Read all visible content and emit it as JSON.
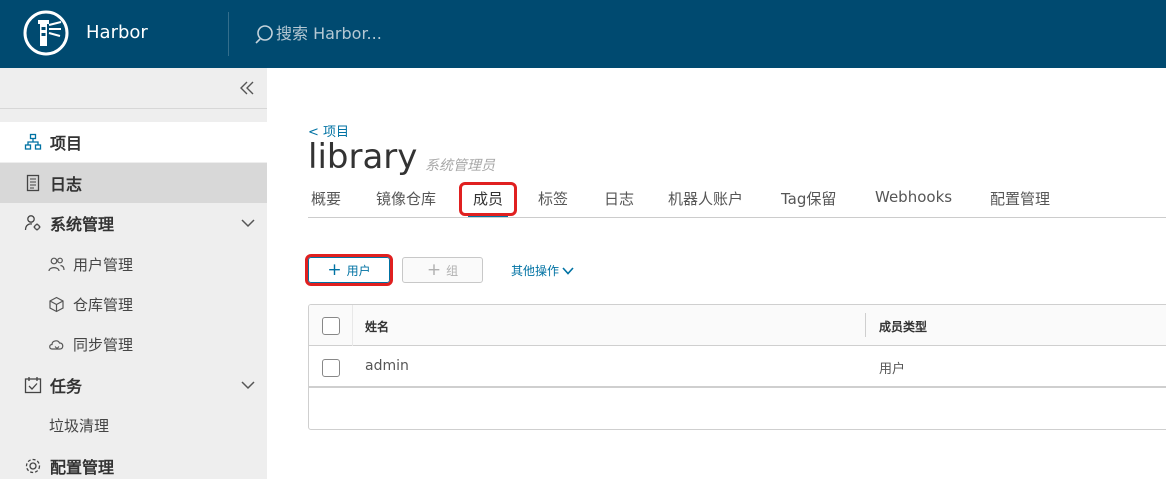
{
  "header": {
    "app_title": "Harbor",
    "search_placeholder": "搜索 Harbor...",
    "background_color": "#004a70"
  },
  "sidebar": {
    "items": [
      {
        "label": "项目",
        "icon": "project-tree-icon"
      },
      {
        "label": "日志",
        "icon": "logs-document-icon"
      },
      {
        "label": "系统管理",
        "icon": "user-gear-icon"
      },
      {
        "label": "用户管理",
        "icon": "users-icon"
      },
      {
        "label": "仓库管理",
        "icon": "cube-icon"
      },
      {
        "label": "同步管理",
        "icon": "cloud-sync-icon"
      },
      {
        "label": "任务",
        "icon": "calendar-check-icon"
      },
      {
        "label": "垃圾清理"
      },
      {
        "label": "配置管理",
        "icon": "gear-icon"
      }
    ]
  },
  "main": {
    "breadcrumb": "< 项目",
    "title": "library",
    "role": "系统管理员",
    "tabs": [
      {
        "label": "概要"
      },
      {
        "label": "镜像仓库"
      },
      {
        "label": "成员"
      },
      {
        "label": "标签"
      },
      {
        "label": "日志"
      },
      {
        "label": "机器人账户"
      },
      {
        "label": "Tag保留"
      },
      {
        "label": "Webhooks"
      },
      {
        "label": "配置管理"
      }
    ],
    "active_tab": "成员",
    "add_user_label": "用户",
    "add_group_label": "组",
    "more_actions_label": "其他操作",
    "table": {
      "columns": [
        "姓名",
        "成员类型"
      ],
      "rows": [
        {
          "name": "admin",
          "type": "用户"
        }
      ]
    },
    "accent_color": "#0072a3",
    "highlight_color": "#e02020"
  }
}
